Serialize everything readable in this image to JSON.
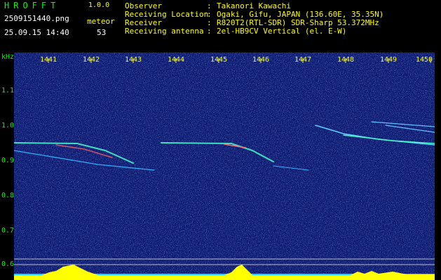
{
  "header": {
    "app_name": "HROFFT",
    "version": "1.0.0",
    "filename": "2509151440.png",
    "datetime": "25.09.15 14:40",
    "meteor_label": "meteor",
    "meteor_count": "53",
    "info": [
      {
        "label": "Observer",
        "value": "Takanori Kawachi"
      },
      {
        "label": "Receiving Location",
        "value": "Ogaki, Gifu, JAPAN (136.60E, 35.35N)"
      },
      {
        "label": "Receiver",
        "value": "R820T2(RTL-SDR) SDR-Sharp 53.372MHz"
      },
      {
        "label": "Receiving antenna",
        "value": "2el-HB9CV Vertical (el. E-W)"
      }
    ]
  },
  "axis": {
    "unit": "kHz",
    "y_ticks": [
      "1.1",
      "1.0",
      "0.9",
      "0.8",
      "0.7",
      "0.6"
    ],
    "x_ticks": [
      "1441",
      "1442",
      "1443",
      "1444",
      "1445",
      "1446",
      "1447",
      "1448",
      "1449",
      "1450"
    ]
  },
  "colors": {
    "background": "#000000",
    "waterfall": "#0a1a70",
    "label_yellow": "#ffff00",
    "label_green": "#00ff00",
    "baseline": "#00e0ff"
  }
}
